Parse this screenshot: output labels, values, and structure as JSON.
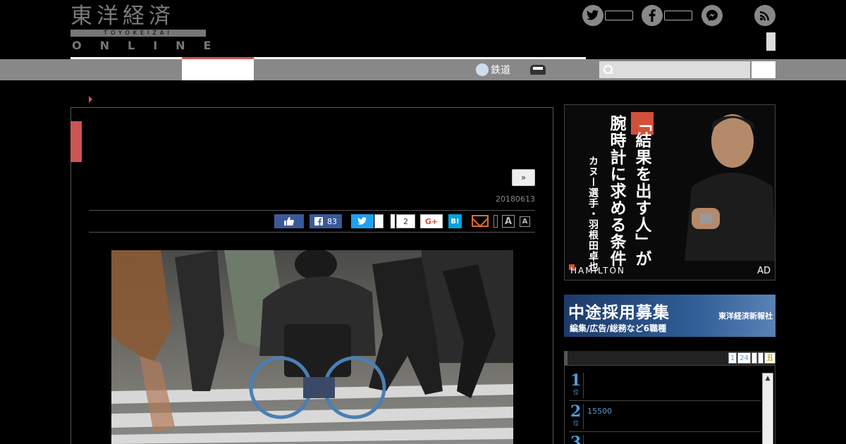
{
  "logo": {
    "kanji": "東洋経済",
    "romaji": "TOYOKEIZAI",
    "online": "ONLINE"
  },
  "nav": {
    "railway_label": "鉄道",
    "search_placeholder": ""
  },
  "article": {
    "next_label": "»",
    "date": "20180613",
    "share": {
      "facebook_count": "83",
      "pocket_count": "2",
      "google_label": "G+",
      "hatena_label": "B!",
      "font_large": "A",
      "font_small": "A"
    }
  },
  "ad": {
    "headline_1": "「結果を出す人」が",
    "headline_2": "腕時計に求める条件",
    "subline": "カヌー選手・羽根田卓也",
    "brand": "HAMILTON",
    "label": "AD"
  },
  "recruit": {
    "title": "中途採用募集",
    "subtitle": "編集/広告/総務など6職種",
    "company": "東洋経済新報社"
  },
  "ranking": {
    "tabs": [
      "1",
      "24",
      "",
      "",
      "丑"
    ],
    "items": [
      {
        "num": "1",
        "suffix": "位",
        "text": ""
      },
      {
        "num": "2",
        "suffix": "位",
        "text": "15500"
      },
      {
        "num": "3",
        "suffix": "位",
        "text": ""
      }
    ]
  },
  "colors": {
    "accent_red": "#cc5555",
    "nav_gray": "#888888",
    "facebook": "#3b5998",
    "twitter": "#1da1f2",
    "hatena": "#00a4de",
    "link_blue": "#4f9bd8"
  }
}
